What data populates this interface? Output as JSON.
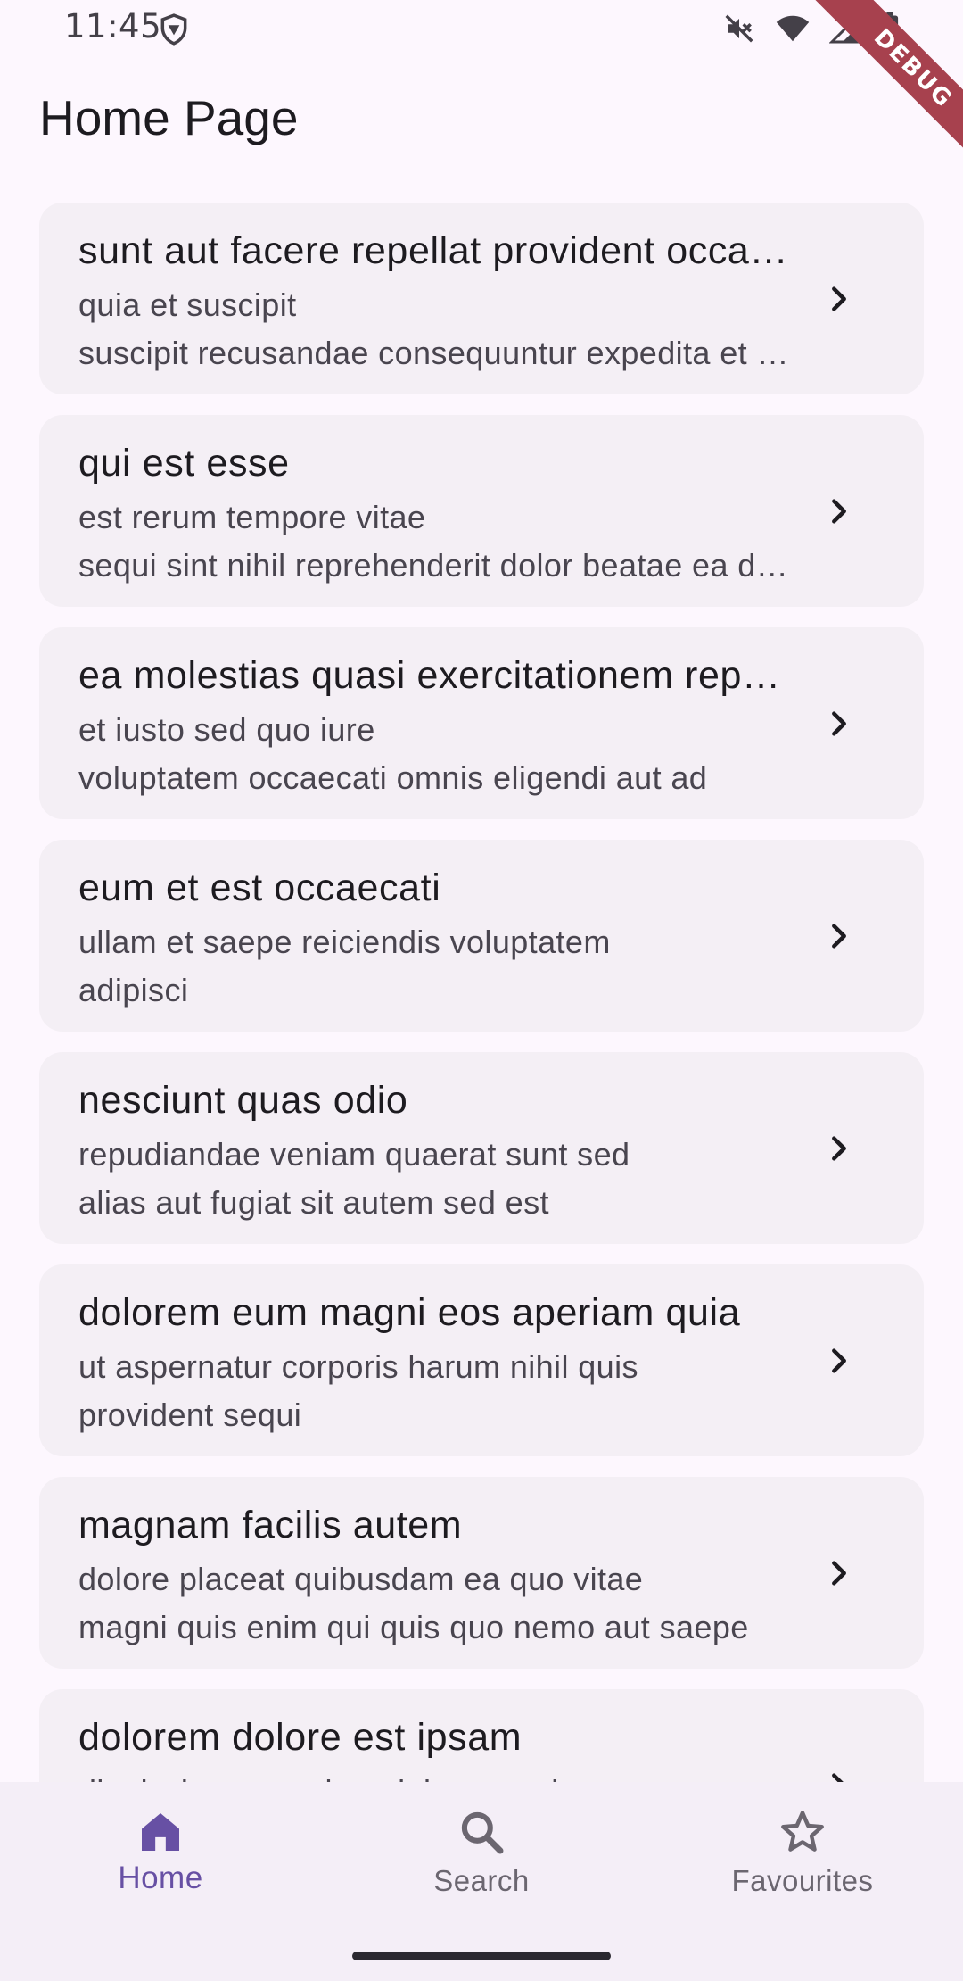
{
  "status_bar": {
    "time": "11:45",
    "icons": [
      "vpn-shield-icon",
      "mute-icon",
      "wifi-icon",
      "signal-icon",
      "battery-icon"
    ]
  },
  "debug_banner": {
    "label": "DEBUG",
    "color": "#a7414e"
  },
  "app_bar": {
    "title": "Home Page"
  },
  "posts": [
    {
      "title": "sunt aut facere repellat provident occaecati excepturi optio reprehenderit",
      "line1": "quia et suscipit",
      "line2": "suscipit recusandae consequuntur expedita et cum"
    },
    {
      "title": "qui est esse",
      "line1": "est rerum tempore vitae",
      "line2": "sequi sint nihil reprehenderit dolor beatae ea dolores neque"
    },
    {
      "title": "ea molestias quasi exercitationem repellat qui ipsa sit aut",
      "line1": "et iusto sed quo iure",
      "line2": "voluptatem occaecati omnis eligendi aut ad"
    },
    {
      "title": "eum et est occaecati",
      "line1": "ullam et saepe reiciendis voluptatem",
      "line2": "adipisci"
    },
    {
      "title": "nesciunt quas odio",
      "line1": "repudiandae veniam quaerat sunt sed",
      "line2": "alias aut fugiat sit autem sed est"
    },
    {
      "title": "dolorem eum magni eos aperiam quia",
      "line1": "ut aspernatur corporis harum nihil quis",
      "line2": "provident sequi"
    },
    {
      "title": "magnam facilis autem",
      "line1": "dolore placeat quibusdam ea quo vitae",
      "line2": "magni quis enim qui quis quo nemo aut saepe"
    },
    {
      "title": "dolorem dolore est ipsam",
      "line1": "dignissimos aperiam dolorem qui eum",
      "line2": ""
    }
  ],
  "bottom_nav": {
    "items": [
      {
        "label": "Home",
        "icon": "home-icon",
        "active": true
      },
      {
        "label": "Search",
        "icon": "search-icon",
        "active": false
      },
      {
        "label": "Favourites",
        "icon": "star-icon",
        "active": false
      }
    ]
  },
  "colors": {
    "background": "#fdf7fe",
    "card": "#f4eff5",
    "accent": "#6750a4",
    "nav_background": "#f4eef7"
  }
}
